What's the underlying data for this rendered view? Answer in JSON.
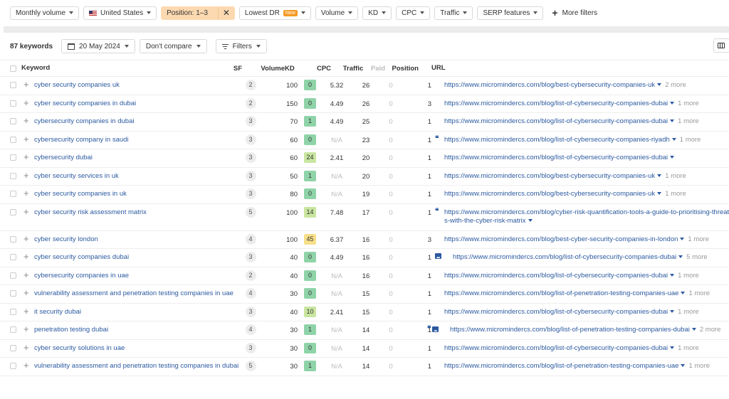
{
  "filters": {
    "monthly_volume": "Monthly volume",
    "country": "United States",
    "position": "Position: 1–3",
    "lowest_dr": "Lowest DR",
    "new_badge": "New",
    "volume": "Volume",
    "kd": "KD",
    "cpc": "CPC",
    "traffic": "Traffic",
    "serp_features": "SERP features",
    "more_filters": "More filters"
  },
  "toolbar": {
    "keyword_count": "87 keywords",
    "date": "20 May 2024",
    "compare": "Don't compare",
    "filters": "Filters"
  },
  "table": {
    "columns": {
      "keyword": "Keyword",
      "sf": "SF",
      "volume": "Volume",
      "kd": "KD",
      "cpc": "CPC",
      "traffic": "Traffic",
      "paid": "Paid",
      "position": "Position",
      "url": "URL"
    },
    "kd_colors": {
      "easy": "#8fd3a8",
      "light": "#c9e6a0",
      "medium": "#f8e08a"
    },
    "rows": [
      {
        "keyword": "cyber security companies uk",
        "sf": "2",
        "volume": "100",
        "kd": "0",
        "kd_level": "easy",
        "cpc": "5.32",
        "traffic": "26",
        "paid": "0",
        "position": "1",
        "url": "https://www.micromindercs.com/blog/best-cybersecurity-companies-uk",
        "more": "2 more",
        "icons": []
      },
      {
        "keyword": "cyber security companies in dubai",
        "sf": "2",
        "volume": "150",
        "kd": "0",
        "kd_level": "easy",
        "cpc": "4.49",
        "traffic": "26",
        "paid": "0",
        "position": "3",
        "url": "https://www.micromindercs.com/blog/list-of-cybersecurity-companies-dubai",
        "more": "1 more",
        "icons": []
      },
      {
        "keyword": "cybersecurity companies in dubai",
        "sf": "3",
        "volume": "70",
        "kd": "1",
        "kd_level": "easy",
        "cpc": "4.49",
        "traffic": "25",
        "paid": "0",
        "position": "1",
        "url": "https://www.micromindercs.com/blog/list-of-cybersecurity-companies-dubai",
        "more": "1 more",
        "icons": []
      },
      {
        "keyword": "cybersecurity company in saudi",
        "sf": "3",
        "volume": "60",
        "kd": "0",
        "kd_level": "easy",
        "cpc": "N/A",
        "traffic": "23",
        "paid": "0",
        "position": "1",
        "url": "https://www.micromindercs.com/blog/list-of-cybersecurity-companies-riyadh",
        "more": "1 more",
        "icons": [
          "quote"
        ]
      },
      {
        "keyword": "cybersecurity dubai",
        "sf": "3",
        "volume": "60",
        "kd": "24",
        "kd_level": "light",
        "cpc": "2.41",
        "traffic": "20",
        "paid": "0",
        "position": "1",
        "url": "https://www.micromindercs.com/blog/list-of-cybersecurity-companies-dubai",
        "more": "",
        "icons": []
      },
      {
        "keyword": "cyber security services in uk",
        "sf": "3",
        "volume": "50",
        "kd": "1",
        "kd_level": "easy",
        "cpc": "N/A",
        "traffic": "20",
        "paid": "0",
        "position": "1",
        "url": "https://www.micromindercs.com/blog/best-cybersecurity-companies-uk",
        "more": "1 more",
        "icons": []
      },
      {
        "keyword": "cyber security companies in uk",
        "sf": "3",
        "volume": "80",
        "kd": "0",
        "kd_level": "easy",
        "cpc": "N/A",
        "traffic": "19",
        "paid": "0",
        "position": "1",
        "url": "https://www.micromindercs.com/blog/best-cybersecurity-companies-uk",
        "more": "1 more",
        "icons": []
      },
      {
        "keyword": "cyber security risk assessment matrix",
        "sf": "5",
        "volume": "100",
        "kd": "14",
        "kd_level": "light",
        "cpc": "7.48",
        "traffic": "17",
        "paid": "0",
        "position": "1",
        "url": "https://www.micromindercs.com/blog/cyber-risk-quantification-tools-a-guide-to-prioritising-threats-with-the-cyber-risk-matrix",
        "more": "",
        "icons": [
          "quote"
        ]
      },
      {
        "keyword": "cyber security london",
        "sf": "4",
        "volume": "100",
        "kd": "45",
        "kd_level": "medium",
        "cpc": "6.37",
        "traffic": "16",
        "paid": "0",
        "position": "3",
        "url": "https://www.micromindercs.com/blog/best-cyber-security-companies-in-london",
        "more": "1 more",
        "icons": []
      },
      {
        "keyword": "cyber security companies dubai",
        "sf": "3",
        "volume": "40",
        "kd": "0",
        "kd_level": "easy",
        "cpc": "4.49",
        "traffic": "16",
        "paid": "0",
        "position": "1",
        "url": "https://www.micromindercs.com/blog/list-of-cybersecurity-companies-dubai",
        "more": "5 more",
        "icons": [
          "image"
        ]
      },
      {
        "keyword": "cybersecurity companies in uae",
        "sf": "2",
        "volume": "40",
        "kd": "0",
        "kd_level": "easy",
        "cpc": "N/A",
        "traffic": "16",
        "paid": "0",
        "position": "1",
        "url": "https://www.micromindercs.com/blog/list-of-cybersecurity-companies-dubai",
        "more": "1 more",
        "icons": []
      },
      {
        "keyword": "vulnerability assessment and penetration testing companies in uae",
        "sf": "4",
        "volume": "30",
        "kd": "0",
        "kd_level": "easy",
        "cpc": "N/A",
        "traffic": "15",
        "paid": "0",
        "position": "1",
        "url": "https://www.micromindercs.com/blog/list-of-penetration-testing-companies-uae",
        "more": "1 more",
        "icons": []
      },
      {
        "keyword": "it security dubai",
        "sf": "3",
        "volume": "40",
        "kd": "10",
        "kd_level": "light",
        "cpc": "2.41",
        "traffic": "15",
        "paid": "0",
        "position": "1",
        "url": "https://www.micromindercs.com/blog/list-of-cybersecurity-companies-dubai",
        "more": "1 more",
        "icons": []
      },
      {
        "keyword": "penetration testing dubai",
        "sf": "4",
        "volume": "30",
        "kd": "1",
        "kd_level": "easy",
        "cpc": "N/A",
        "traffic": "14",
        "paid": "0",
        "position": "1",
        "url": "https://www.micromindercs.com/blog/list-of-penetration-testing-companies-dubai",
        "more": "2 more",
        "icons": [
          "quote",
          "image"
        ]
      },
      {
        "keyword": "cyber security solutions in uae",
        "sf": "3",
        "volume": "30",
        "kd": "0",
        "kd_level": "easy",
        "cpc": "N/A",
        "traffic": "14",
        "paid": "0",
        "position": "1",
        "url": "https://www.micromindercs.com/blog/list-of-cybersecurity-companies-dubai",
        "more": "1 more",
        "icons": []
      },
      {
        "keyword": "vulnerability assessment and penetration testing companies in dubai",
        "sf": "5",
        "volume": "30",
        "kd": "1",
        "kd_level": "easy",
        "cpc": "N/A",
        "traffic": "14",
        "paid": "0",
        "position": "1",
        "url": "https://www.micromindercs.com/blog/list-of-penetration-testing-companies-uae",
        "more": "1 more",
        "icons": []
      }
    ]
  }
}
